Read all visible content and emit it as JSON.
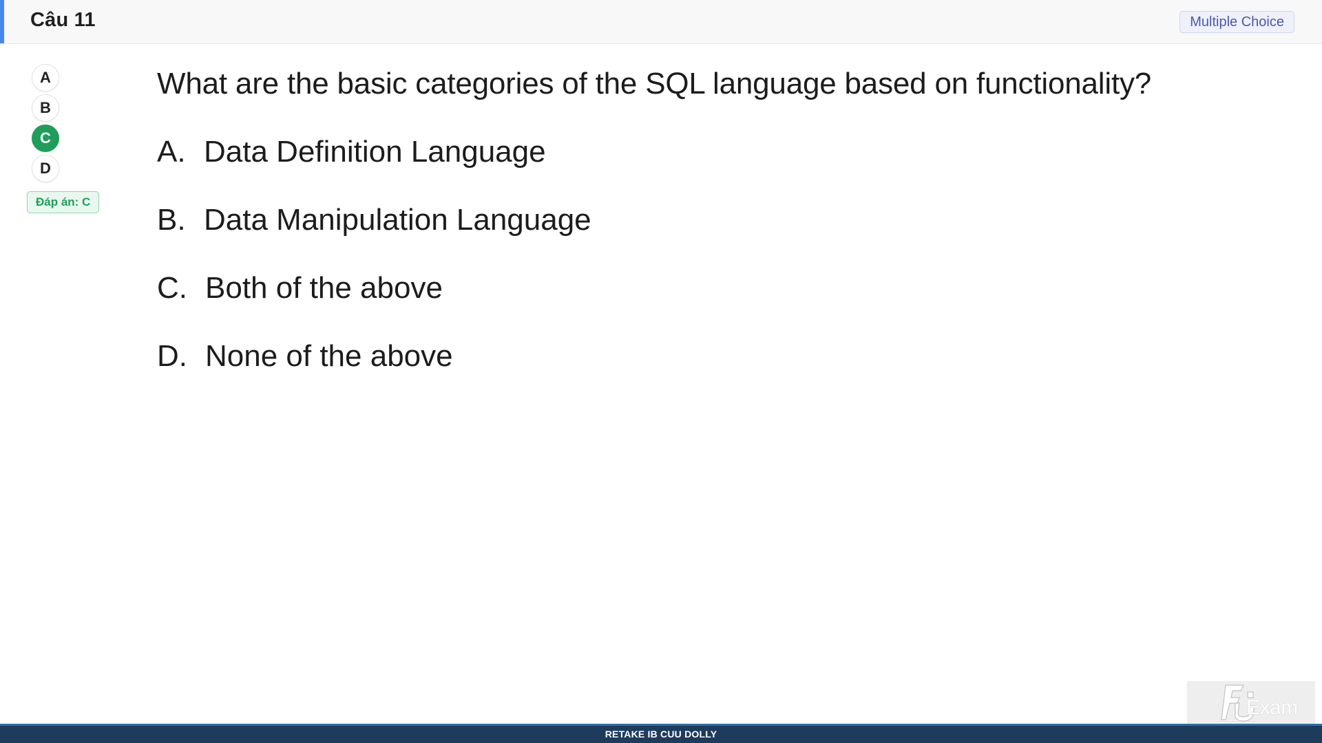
{
  "header": {
    "title": "Câu 11",
    "type_badge": "Multiple Choice"
  },
  "answer_panel": {
    "choices": [
      {
        "label": "A",
        "selected": false
      },
      {
        "label": "B",
        "selected": false
      },
      {
        "label": "C",
        "selected": true
      },
      {
        "label": "D",
        "selected": false
      }
    ],
    "answer_label": "Đáp án: C",
    "correct_color": "#1e9e5a"
  },
  "question": {
    "text": "What are the basic categories of the SQL language based on functionality?",
    "options": [
      {
        "letter": "A.",
        "text": "Data Definition Language"
      },
      {
        "letter": "B.",
        "text": "Data Manipulation Language"
      },
      {
        "letter": "C.",
        "text": "Both of the above"
      },
      {
        "letter": "D.",
        "text": "None of the above"
      }
    ]
  },
  "footer": {
    "text": "RETAKE IB CUU DOLLY"
  },
  "logo": {
    "text": "Exam",
    "icon": "fu-logo-icon"
  },
  "colors": {
    "accent": "#4a86e8",
    "footer_bg": "#1e3b5c",
    "badge_text": "#4a5aa8"
  }
}
